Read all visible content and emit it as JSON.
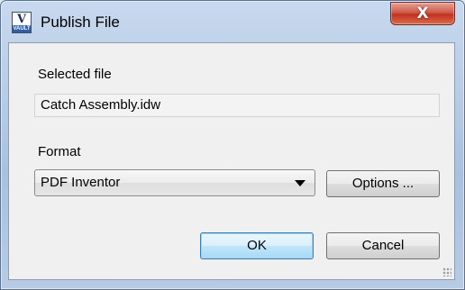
{
  "window": {
    "title": "Publish File",
    "app_icon": "vault-app-icon",
    "app_icon_letter": "V",
    "app_icon_badge": "VAULT",
    "close_glyph": "X"
  },
  "selected_file": {
    "label": "Selected file",
    "value": "Catch Assembly.idw"
  },
  "format": {
    "label": "Format",
    "selected": "PDF Inventor",
    "options_label": "Options ..."
  },
  "actions": {
    "ok_label": "OK",
    "cancel_label": "Cancel"
  },
  "colors": {
    "close_button": "#c1321e",
    "default_button_border": "#3c7fb1",
    "window_frame": "#b9cde6"
  }
}
